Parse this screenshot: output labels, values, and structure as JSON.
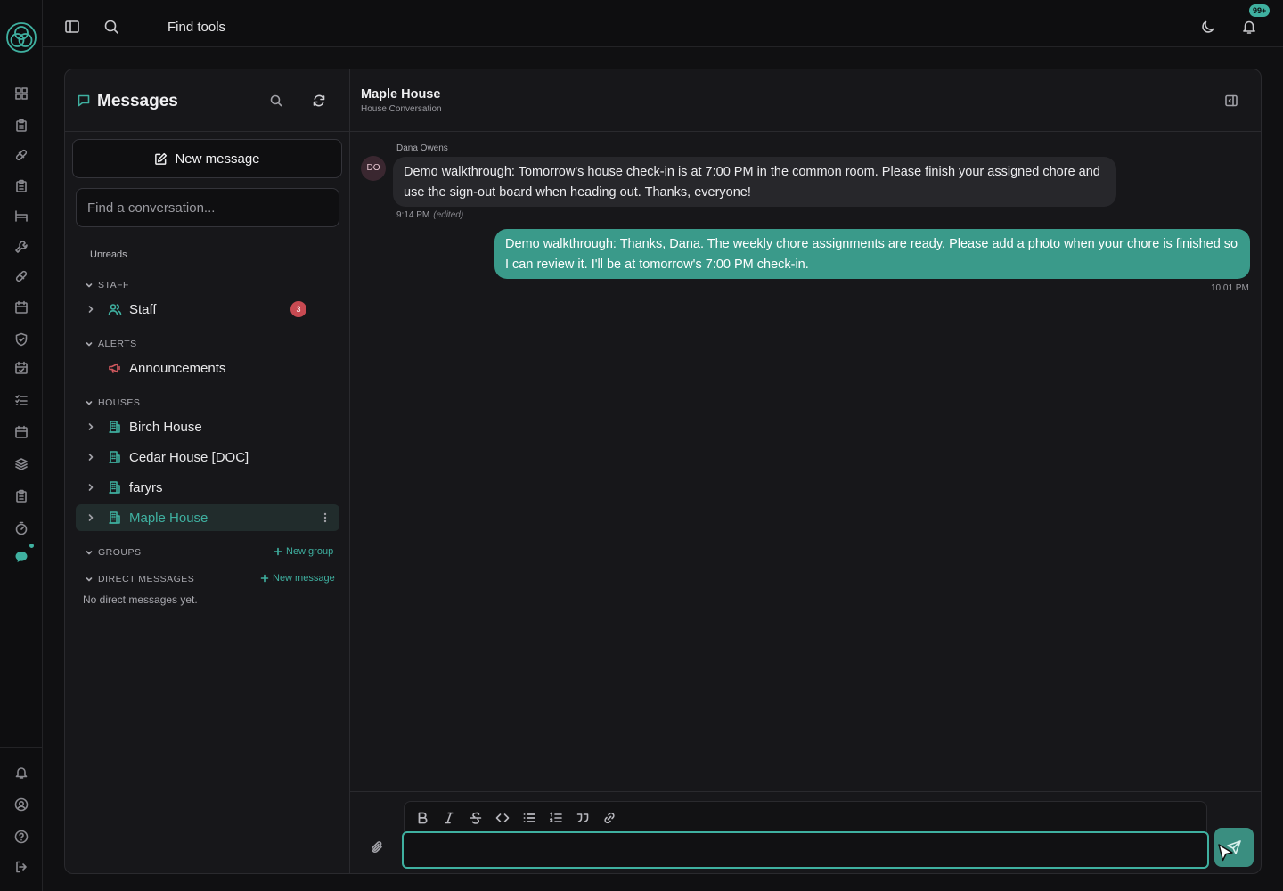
{
  "topbar": {
    "find_tools": "Find tools",
    "notification_count": "99+"
  },
  "rail": {
    "icons": [
      "grid-icon",
      "clipboard-icon",
      "pill-icon",
      "clipboard-icon",
      "bed-icon",
      "wrench-icon",
      "pill-icon",
      "calendar-icon",
      "shield-icon",
      "calendar-check-icon",
      "list-check-icon",
      "calendar-icon",
      "layers-icon",
      "clipboard-icon",
      "timer-icon",
      "chat-icon"
    ],
    "bottom_icons": [
      "bell-icon",
      "user-circle-icon",
      "help-icon",
      "logout-icon"
    ]
  },
  "sidebar": {
    "title": "Messages",
    "new_message": "New message",
    "find_placeholder": "Find a conversation...",
    "unreads": "Unreads",
    "sections": {
      "staff": "STAFF",
      "alerts": "ALERTS",
      "houses": "HOUSES",
      "groups": "GROUPS",
      "direct": "DIRECT MESSAGES"
    },
    "staff_item": {
      "label": "Staff",
      "count": "3"
    },
    "alerts_item": {
      "label": "Announcements"
    },
    "houses": [
      "Birch House",
      "Cedar House [DOC]",
      "faryrs",
      "Maple House"
    ],
    "selected_house": "Maple House",
    "new_group": "New group",
    "new_dm": "New message",
    "no_dm": "No direct messages yet."
  },
  "conversation": {
    "title": "Maple House",
    "subtitle": "House Conversation",
    "messages": [
      {
        "sender": "Dana Owens",
        "initials": "DO",
        "text": "Demo walkthrough: Tomorrow's house check-in is at 7:00 PM in the common room. Please finish your assigned chore and use the sign-out board when heading out. Thanks, everyone!",
        "time": "9:14 PM",
        "edited": "(edited)"
      },
      {
        "text": "Demo walkthrough: Thanks, Dana. The weekly chore assignments are ready. Please add a photo when your chore is finished so I can review it. I'll be at tomorrow's 7:00 PM check-in.",
        "time": "10:01 PM"
      }
    ]
  },
  "colors": {
    "accent": "#3fb0a0",
    "outgoing_bubble": "#3a9a8a",
    "incoming_bubble": "#27272b",
    "unread_badge": "#c84a52"
  }
}
